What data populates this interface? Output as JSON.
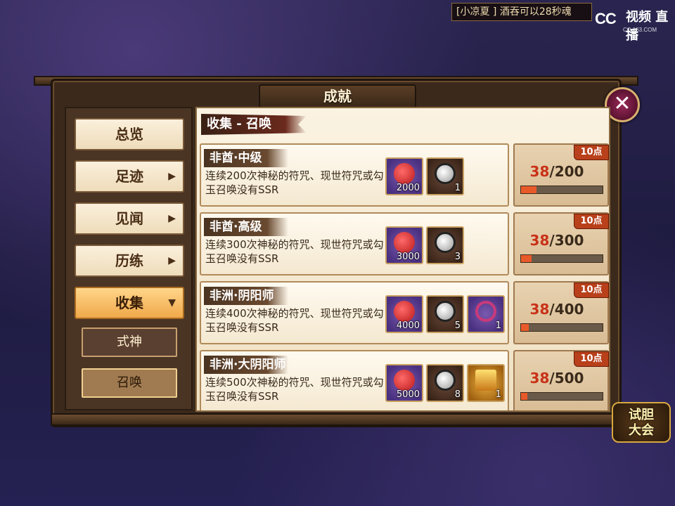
{
  "notice": {
    "text": "[小凉夏     ] 酒吞可以28秒魂"
  },
  "watermark": {
    "logo": "CC",
    "brand": "视频 直播",
    "url": "CC.163.COM"
  },
  "window": {
    "title": "成就",
    "close_icon": "close-icon"
  },
  "sidebar": {
    "items": [
      {
        "label": "总览",
        "has_arrow": false
      },
      {
        "label": "足迹",
        "has_arrow": true
      },
      {
        "label": "见闻",
        "has_arrow": true
      },
      {
        "label": "历练",
        "has_arrow": true
      },
      {
        "label": "收集",
        "has_arrow": true,
        "active": true
      }
    ],
    "sub_items": [
      {
        "label": "式神",
        "selected": false
      },
      {
        "label": "召唤",
        "selected": true
      }
    ],
    "arrow_right": "▶",
    "arrow_down": "▼"
  },
  "section": {
    "label": "收集 - 召唤"
  },
  "achievements": [
    {
      "title": "非酋·中级",
      "desc": "连续200次神秘的符咒、现世符咒或勾玉召唤没有SSR",
      "rewards": [
        {
          "type": "jade",
          "count": "2000"
        },
        {
          "type": "daruma",
          "count": "1"
        }
      ],
      "points": "10点",
      "current": "38",
      "total": "/200",
      "progress": 0.19
    },
    {
      "title": "非酋·高级",
      "desc": "连续300次神秘的符咒、现世符咒或勾玉召唤没有SSR",
      "rewards": [
        {
          "type": "jade",
          "count": "3000"
        },
        {
          "type": "daruma",
          "count": "3"
        }
      ],
      "points": "10点",
      "current": "38",
      "total": "/300",
      "progress": 0.127
    },
    {
      "title": "非洲·阴阳师",
      "desc": "连续400次神秘的符咒、现世符咒或勾玉召唤没有SSR",
      "rewards": [
        {
          "type": "jade",
          "count": "4000"
        },
        {
          "type": "daruma",
          "count": "5"
        },
        {
          "type": "ring",
          "count": "1"
        }
      ],
      "points": "10点",
      "current": "38",
      "total": "/400",
      "progress": 0.095
    },
    {
      "title": "非洲·大阴阳师",
      "desc": "连续500次神秘的符咒、现世符咒或勾玉召唤没有SSR",
      "rewards": [
        {
          "type": "jade",
          "count": "5000"
        },
        {
          "type": "daruma",
          "count": "8"
        },
        {
          "type": "ssr",
          "count": "1"
        }
      ],
      "points": "10点",
      "current": "38",
      "total": "/500",
      "progress": 0.076
    }
  ],
  "event_badge": {
    "line1": "试胆",
    "line2": "大会"
  }
}
